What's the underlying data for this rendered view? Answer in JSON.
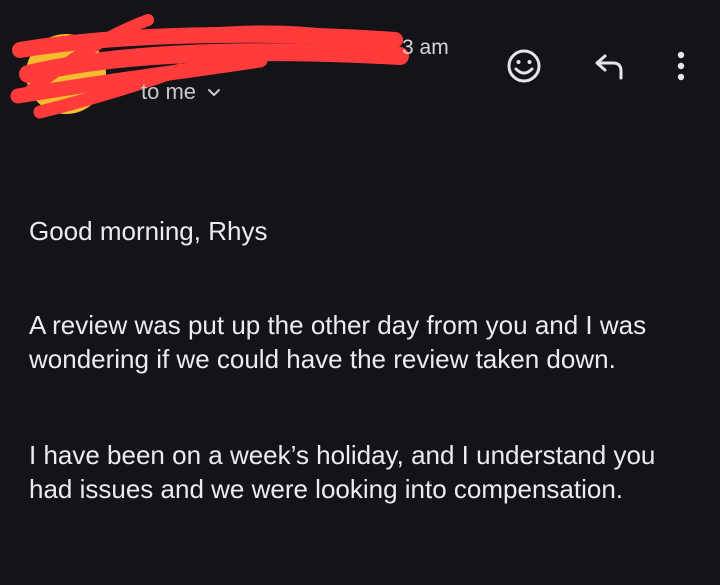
{
  "email": {
    "time_visible": "3 am",
    "recipient_label": "to me",
    "greeting": "Good morning, Rhys",
    "paragraphs": [
      "A review was put up the other day from you and I was wondering if we could have the review taken down.",
      "I have been on a week’s holiday, and I understand you had issues and we were looking into compensation."
    ]
  },
  "icons": {
    "avatar": "avatar",
    "recipient_expand": "chevron-down-icon",
    "emoji": "emoji-reaction-icon",
    "reply": "reply-icon",
    "more": "more-vertical-icon"
  },
  "colors": {
    "background": "#141418",
    "avatar": "#f4bd2e",
    "redaction": "#ff3b3b",
    "text": "#ececee"
  }
}
